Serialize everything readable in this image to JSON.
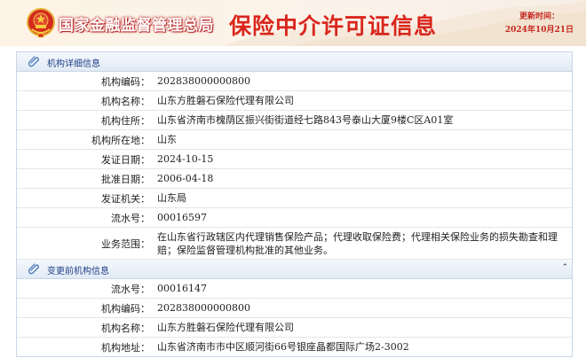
{
  "header": {
    "org_name": "国家金融监督管理总局",
    "page_title": "保险中介许可证信息",
    "update_label": "更新时间：",
    "update_date": "2024年10月21日"
  },
  "section_detail": {
    "title": "机构详细信息",
    "rows": [
      {
        "label": "机构编码：",
        "value": "202838000000800"
      },
      {
        "label": "机构名称：",
        "value": "山东方胜磐石保险代理有限公司"
      },
      {
        "label": "机构住所：",
        "value": "山东省济南市槐荫区振兴街街道经七路843号泰山大厦9楼C区A01室"
      },
      {
        "label": "机构所在地：",
        "value": "山东"
      },
      {
        "label": "发证日期：",
        "value": "2024-10-15"
      },
      {
        "label": "批准日期：",
        "value": "2006-04-18"
      },
      {
        "label": "发证机关：",
        "value": "山东局"
      },
      {
        "label": "流水号：",
        "value": "00016597"
      },
      {
        "label": "业务范围：",
        "value": "在山东省行政辖区内代理销售保险产品；代理收取保险费；代理相关保险业务的损失勘查和理赔；保险监督管理机构批准的其他业务。"
      }
    ]
  },
  "section_prev": {
    "title": "变更前机构信息",
    "collapse_icon": "double-chevron-up-icon",
    "rows": [
      {
        "label": "流水号：",
        "value": "00016147"
      },
      {
        "label": "机构编码：",
        "value": "202838000000800"
      },
      {
        "label": "机构名称：",
        "value": "山东方胜磐石保险代理有限公司"
      },
      {
        "label": "机构地址：",
        "value": "山东省济南市市中区顺河街66号银座晶都国际广场2-3002"
      }
    ]
  },
  "colors": {
    "brand_red": "#d9261c",
    "section_blue": "#23428a",
    "border": "#c9d6e6"
  }
}
